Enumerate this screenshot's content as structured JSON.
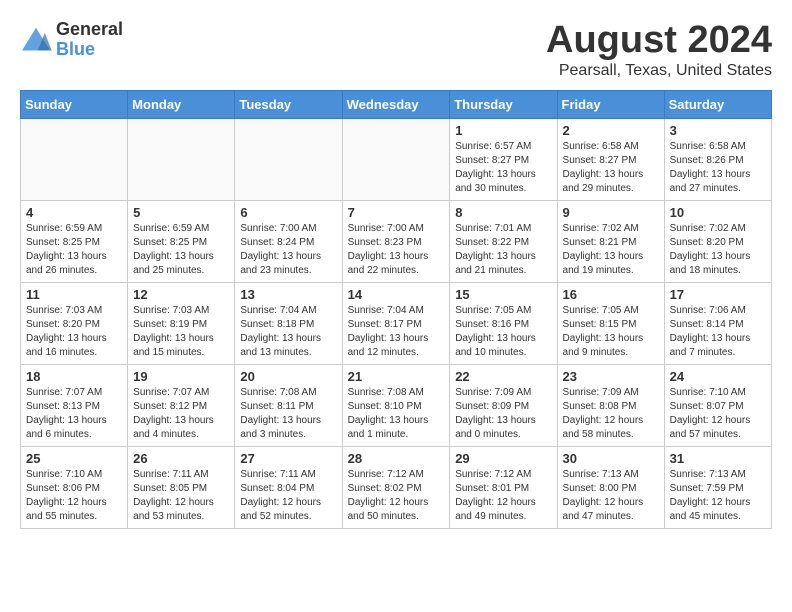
{
  "logo": {
    "general": "General",
    "blue": "Blue"
  },
  "header": {
    "title": "August 2024",
    "subtitle": "Pearsall, Texas, United States"
  },
  "weekdays": [
    "Sunday",
    "Monday",
    "Tuesday",
    "Wednesday",
    "Thursday",
    "Friday",
    "Saturday"
  ],
  "weeks": [
    [
      {
        "day": "",
        "sunrise": "",
        "sunset": "",
        "daylight": ""
      },
      {
        "day": "",
        "sunrise": "",
        "sunset": "",
        "daylight": ""
      },
      {
        "day": "",
        "sunrise": "",
        "sunset": "",
        "daylight": ""
      },
      {
        "day": "",
        "sunrise": "",
        "sunset": "",
        "daylight": ""
      },
      {
        "day": "1",
        "sunrise": "Sunrise: 6:57 AM",
        "sunset": "Sunset: 8:27 PM",
        "daylight": "Daylight: 13 hours and 30 minutes."
      },
      {
        "day": "2",
        "sunrise": "Sunrise: 6:58 AM",
        "sunset": "Sunset: 8:27 PM",
        "daylight": "Daylight: 13 hours and 29 minutes."
      },
      {
        "day": "3",
        "sunrise": "Sunrise: 6:58 AM",
        "sunset": "Sunset: 8:26 PM",
        "daylight": "Daylight: 13 hours and 27 minutes."
      }
    ],
    [
      {
        "day": "4",
        "sunrise": "Sunrise: 6:59 AM",
        "sunset": "Sunset: 8:25 PM",
        "daylight": "Daylight: 13 hours and 26 minutes."
      },
      {
        "day": "5",
        "sunrise": "Sunrise: 6:59 AM",
        "sunset": "Sunset: 8:25 PM",
        "daylight": "Daylight: 13 hours and 25 minutes."
      },
      {
        "day": "6",
        "sunrise": "Sunrise: 7:00 AM",
        "sunset": "Sunset: 8:24 PM",
        "daylight": "Daylight: 13 hours and 23 minutes."
      },
      {
        "day": "7",
        "sunrise": "Sunrise: 7:00 AM",
        "sunset": "Sunset: 8:23 PM",
        "daylight": "Daylight: 13 hours and 22 minutes."
      },
      {
        "day": "8",
        "sunrise": "Sunrise: 7:01 AM",
        "sunset": "Sunset: 8:22 PM",
        "daylight": "Daylight: 13 hours and 21 minutes."
      },
      {
        "day": "9",
        "sunrise": "Sunrise: 7:02 AM",
        "sunset": "Sunset: 8:21 PM",
        "daylight": "Daylight: 13 hours and 19 minutes."
      },
      {
        "day": "10",
        "sunrise": "Sunrise: 7:02 AM",
        "sunset": "Sunset: 8:20 PM",
        "daylight": "Daylight: 13 hours and 18 minutes."
      }
    ],
    [
      {
        "day": "11",
        "sunrise": "Sunrise: 7:03 AM",
        "sunset": "Sunset: 8:20 PM",
        "daylight": "Daylight: 13 hours and 16 minutes."
      },
      {
        "day": "12",
        "sunrise": "Sunrise: 7:03 AM",
        "sunset": "Sunset: 8:19 PM",
        "daylight": "Daylight: 13 hours and 15 minutes."
      },
      {
        "day": "13",
        "sunrise": "Sunrise: 7:04 AM",
        "sunset": "Sunset: 8:18 PM",
        "daylight": "Daylight: 13 hours and 13 minutes."
      },
      {
        "day": "14",
        "sunrise": "Sunrise: 7:04 AM",
        "sunset": "Sunset: 8:17 PM",
        "daylight": "Daylight: 13 hours and 12 minutes."
      },
      {
        "day": "15",
        "sunrise": "Sunrise: 7:05 AM",
        "sunset": "Sunset: 8:16 PM",
        "daylight": "Daylight: 13 hours and 10 minutes."
      },
      {
        "day": "16",
        "sunrise": "Sunrise: 7:05 AM",
        "sunset": "Sunset: 8:15 PM",
        "daylight": "Daylight: 13 hours and 9 minutes."
      },
      {
        "day": "17",
        "sunrise": "Sunrise: 7:06 AM",
        "sunset": "Sunset: 8:14 PM",
        "daylight": "Daylight: 13 hours and 7 minutes."
      }
    ],
    [
      {
        "day": "18",
        "sunrise": "Sunrise: 7:07 AM",
        "sunset": "Sunset: 8:13 PM",
        "daylight": "Daylight: 13 hours and 6 minutes."
      },
      {
        "day": "19",
        "sunrise": "Sunrise: 7:07 AM",
        "sunset": "Sunset: 8:12 PM",
        "daylight": "Daylight: 13 hours and 4 minutes."
      },
      {
        "day": "20",
        "sunrise": "Sunrise: 7:08 AM",
        "sunset": "Sunset: 8:11 PM",
        "daylight": "Daylight: 13 hours and 3 minutes."
      },
      {
        "day": "21",
        "sunrise": "Sunrise: 7:08 AM",
        "sunset": "Sunset: 8:10 PM",
        "daylight": "Daylight: 13 hours and 1 minute."
      },
      {
        "day": "22",
        "sunrise": "Sunrise: 7:09 AM",
        "sunset": "Sunset: 8:09 PM",
        "daylight": "Daylight: 13 hours and 0 minutes."
      },
      {
        "day": "23",
        "sunrise": "Sunrise: 7:09 AM",
        "sunset": "Sunset: 8:08 PM",
        "daylight": "Daylight: 12 hours and 58 minutes."
      },
      {
        "day": "24",
        "sunrise": "Sunrise: 7:10 AM",
        "sunset": "Sunset: 8:07 PM",
        "daylight": "Daylight: 12 hours and 57 minutes."
      }
    ],
    [
      {
        "day": "25",
        "sunrise": "Sunrise: 7:10 AM",
        "sunset": "Sunset: 8:06 PM",
        "daylight": "Daylight: 12 hours and 55 minutes."
      },
      {
        "day": "26",
        "sunrise": "Sunrise: 7:11 AM",
        "sunset": "Sunset: 8:05 PM",
        "daylight": "Daylight: 12 hours and 53 minutes."
      },
      {
        "day": "27",
        "sunrise": "Sunrise: 7:11 AM",
        "sunset": "Sunset: 8:04 PM",
        "daylight": "Daylight: 12 hours and 52 minutes."
      },
      {
        "day": "28",
        "sunrise": "Sunrise: 7:12 AM",
        "sunset": "Sunset: 8:02 PM",
        "daylight": "Daylight: 12 hours and 50 minutes."
      },
      {
        "day": "29",
        "sunrise": "Sunrise: 7:12 AM",
        "sunset": "Sunset: 8:01 PM",
        "daylight": "Daylight: 12 hours and 49 minutes."
      },
      {
        "day": "30",
        "sunrise": "Sunrise: 7:13 AM",
        "sunset": "Sunset: 8:00 PM",
        "daylight": "Daylight: 12 hours and 47 minutes."
      },
      {
        "day": "31",
        "sunrise": "Sunrise: 7:13 AM",
        "sunset": "Sunset: 7:59 PM",
        "daylight": "Daylight: 12 hours and 45 minutes."
      }
    ]
  ]
}
